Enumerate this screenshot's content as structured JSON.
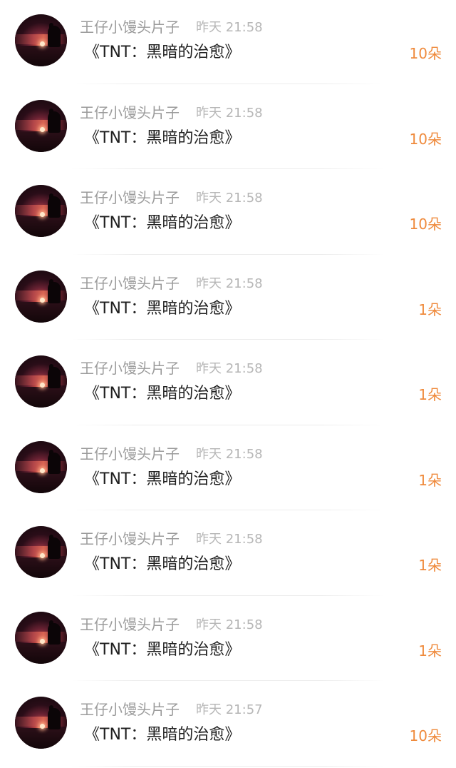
{
  "messages": [
    {
      "name": "王仔小馒头片子",
      "time": "昨天 21:58",
      "title": "《TNT：黑暗的治愈》",
      "count": "10朵"
    },
    {
      "name": "王仔小馒头片子",
      "time": "昨天 21:58",
      "title": "《TNT：黑暗的治愈》",
      "count": "10朵"
    },
    {
      "name": "王仔小馒头片子",
      "time": "昨天 21:58",
      "title": "《TNT：黑暗的治愈》",
      "count": "10朵"
    },
    {
      "name": "王仔小馒头片子",
      "time": "昨天 21:58",
      "title": "《TNT：黑暗的治愈》",
      "count": "1朵"
    },
    {
      "name": "王仔小馒头片子",
      "time": "昨天 21:58",
      "title": "《TNT：黑暗的治愈》",
      "count": "1朵"
    },
    {
      "name": "王仔小馒头片子",
      "time": "昨天 21:58",
      "title": "《TNT：黑暗的治愈》",
      "count": "1朵"
    },
    {
      "name": "王仔小馒头片子",
      "time": "昨天 21:58",
      "title": "《TNT：黑暗的治愈》",
      "count": "1朵"
    },
    {
      "name": "王仔小馒头片子",
      "time": "昨天 21:58",
      "title": "《TNT：黑暗的治愈》",
      "count": "1朵"
    },
    {
      "name": "王仔小馒头片子",
      "time": "昨天 21:57",
      "title": "《TNT：黑暗的治愈》",
      "count": "10朵"
    }
  ],
  "colors": {
    "accent": "#ef8a3c",
    "name_text": "#9b9b9b",
    "time_text": "#b6b6b6",
    "title_text": "#1f1f1f"
  },
  "icons": {
    "avatar": "sunset-avatar-image"
  }
}
